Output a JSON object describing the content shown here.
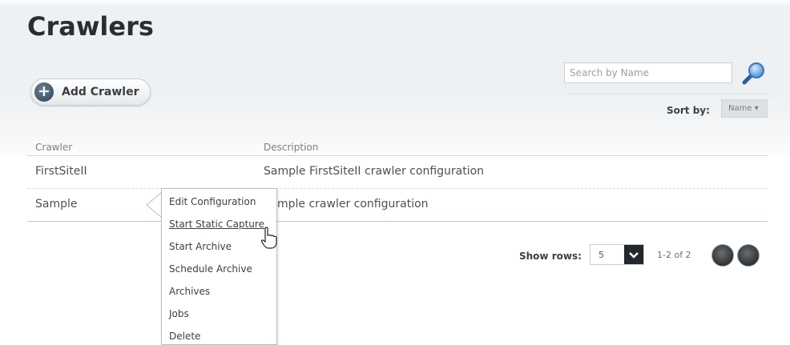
{
  "page": {
    "title": "Crawlers"
  },
  "toolbar": {
    "add_label": "Add Crawler",
    "add_icon": "plus-circle-icon"
  },
  "search": {
    "placeholder": "Search by Name",
    "value": "",
    "icon": "magnifier-icon"
  },
  "sort": {
    "label": "Sort by:",
    "selected": "Name"
  },
  "table": {
    "columns": [
      "Crawler",
      "Description"
    ],
    "rows": [
      {
        "name": "FirstSiteII",
        "description": "Sample FirstSiteII crawler configuration"
      },
      {
        "name": "Sample",
        "description": "mple crawler configuration"
      }
    ]
  },
  "context_menu": {
    "items": [
      "Edit Configuration",
      "Start Static Capture",
      "Start Archive",
      "Schedule Archive",
      "Archives",
      "Jobs",
      "Delete"
    ],
    "hovered": "Start Static Capture"
  },
  "pagination": {
    "rows_label": "Show rows:",
    "rows_value": "5",
    "count": "1-2 of 2"
  },
  "colors": {
    "title": "#2a2e33",
    "text": "#4c5156",
    "header_text": "#7b8086",
    "add_icon": "#2d4457",
    "search_icon": "#4a90d9",
    "pager_button": "#3a3e42"
  }
}
